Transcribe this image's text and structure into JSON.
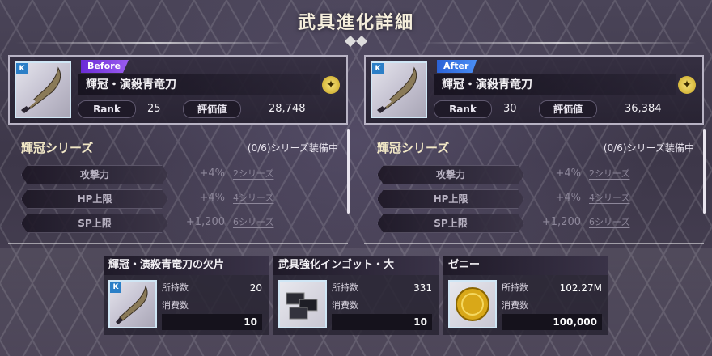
{
  "title": "武具進化詳細",
  "before": {
    "tag": "Before",
    "rarity_icon": "K",
    "name": "輝冠・演殺青竜刀",
    "rank_label": "Rank",
    "rank": "25",
    "score_label": "評価値",
    "score": "28,748",
    "series_name": "輝冠シリーズ",
    "series_count": "(0/6)シリーズ装備中",
    "bonuses": [
      {
        "label": "攻撃力",
        "value": "+4%",
        "series": "2シリーズ"
      },
      {
        "label": "HP上限",
        "value": "+4%",
        "series": "4シリーズ"
      },
      {
        "label": "SP上限",
        "value": "+1,200",
        "series": "6シリーズ"
      }
    ]
  },
  "after": {
    "tag": "After",
    "rarity_icon": "K",
    "name": "輝冠・演殺青竜刀",
    "rank_label": "Rank",
    "rank": "30",
    "score_label": "評価値",
    "score": "36,384",
    "series_name": "輝冠シリーズ",
    "series_count": "(0/6)シリーズ装備中",
    "bonuses": [
      {
        "label": "攻撃力",
        "value": "+4%",
        "series": "2シリーズ"
      },
      {
        "label": "HP上限",
        "value": "+4%",
        "series": "4シリーズ"
      },
      {
        "label": "SP上限",
        "value": "+1,200",
        "series": "6シリーズ"
      }
    ]
  },
  "materials": [
    {
      "name": "輝冠・演殺青竜刀の欠片",
      "owned_label": "所持数",
      "owned": "20",
      "use_label": "消費数",
      "use": "10",
      "icon": "sword-fragment-icon"
    },
    {
      "name": "武具強化インゴット・大",
      "owned_label": "所持数",
      "owned": "331",
      "use_label": "消費数",
      "use": "10",
      "icon": "ingot-icon"
    },
    {
      "name": "ゼニー",
      "owned_label": "所持数",
      "owned": "102.27M",
      "use_label": "消費数",
      "use": "100,000",
      "icon": "coin-icon"
    }
  ],
  "colors": {
    "before_tag": "#7a3ae0",
    "after_tag": "#3a78e8",
    "series_title": "#f1e7c6"
  }
}
